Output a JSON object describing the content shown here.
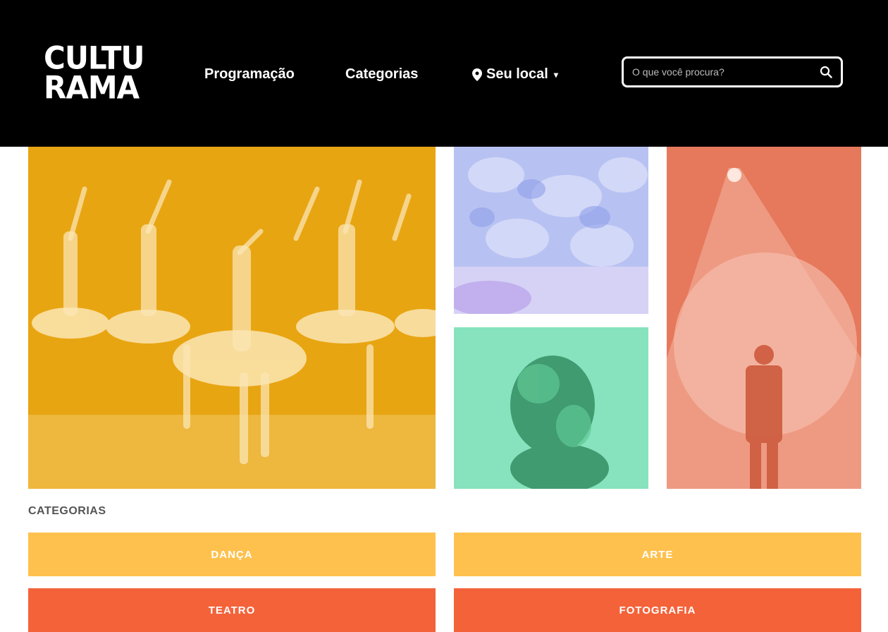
{
  "brand": {
    "logo_line1": "CULTU",
    "logo_line2": "RAMA"
  },
  "nav": {
    "programacao": "Programação",
    "categorias": "Categorias",
    "local": "Seu local"
  },
  "search": {
    "placeholder": "O que você procura?"
  },
  "section": {
    "title": "CATEGORIAS"
  },
  "categories": [
    {
      "label": "DANÇA",
      "color": "#ffc14e"
    },
    {
      "label": "ARTE",
      "color": "#ffc14e"
    },
    {
      "label": "TEATRO",
      "color": "#f4623a"
    },
    {
      "label": "FOTOGRAFIA",
      "color": "#f4623a"
    }
  ],
  "colors": {
    "header": "#000000",
    "tile_dance": "#e8a512",
    "tile_art": "#b8c2f2",
    "tile_photo": "#7ee0b6",
    "tile_theatre": "#e6785c"
  }
}
